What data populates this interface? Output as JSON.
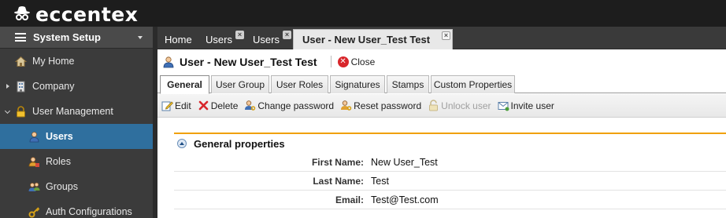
{
  "app": {
    "name": "eccentex"
  },
  "sidebar": {
    "header": "System Setup",
    "items": [
      {
        "label": "My Home",
        "icon": "home-icon"
      },
      {
        "label": "Company",
        "icon": "building-icon"
      },
      {
        "label": "User Management",
        "icon": "lock-icon"
      },
      {
        "label": "Users",
        "icon": "user-icon"
      },
      {
        "label": "Roles",
        "icon": "roles-icon"
      },
      {
        "label": "Groups",
        "icon": "groups-icon"
      },
      {
        "label": "Auth Configurations",
        "icon": "key-icon"
      }
    ]
  },
  "tabs": [
    {
      "label": "Home"
    },
    {
      "label": "Users"
    },
    {
      "label": "Users"
    },
    {
      "label": "User - New User_Test Test"
    }
  ],
  "page": {
    "title": "User - New User_Test Test",
    "close_label": "Close"
  },
  "subtabs": [
    "General",
    "User Group",
    "User Roles",
    "Signatures",
    "Stamps",
    "Custom Properties"
  ],
  "toolbar": {
    "edit": "Edit",
    "delete": "Delete",
    "change_password": "Change password",
    "reset_password": "Reset password",
    "unlock_user": "Unlock user",
    "invite_user": "Invite user"
  },
  "general": {
    "heading": "General properties",
    "fields": [
      {
        "label": "First Name:",
        "value": "New User_Test"
      },
      {
        "label": "Last Name:",
        "value": "Test"
      },
      {
        "label": "Email:",
        "value": "Test@Test.com"
      }
    ]
  },
  "colors": {
    "topbar": "#1d1d1d",
    "sidebar": "#3b3b3b",
    "active_nav": "#2f6f9e",
    "panel_accent": "#f0a000"
  }
}
